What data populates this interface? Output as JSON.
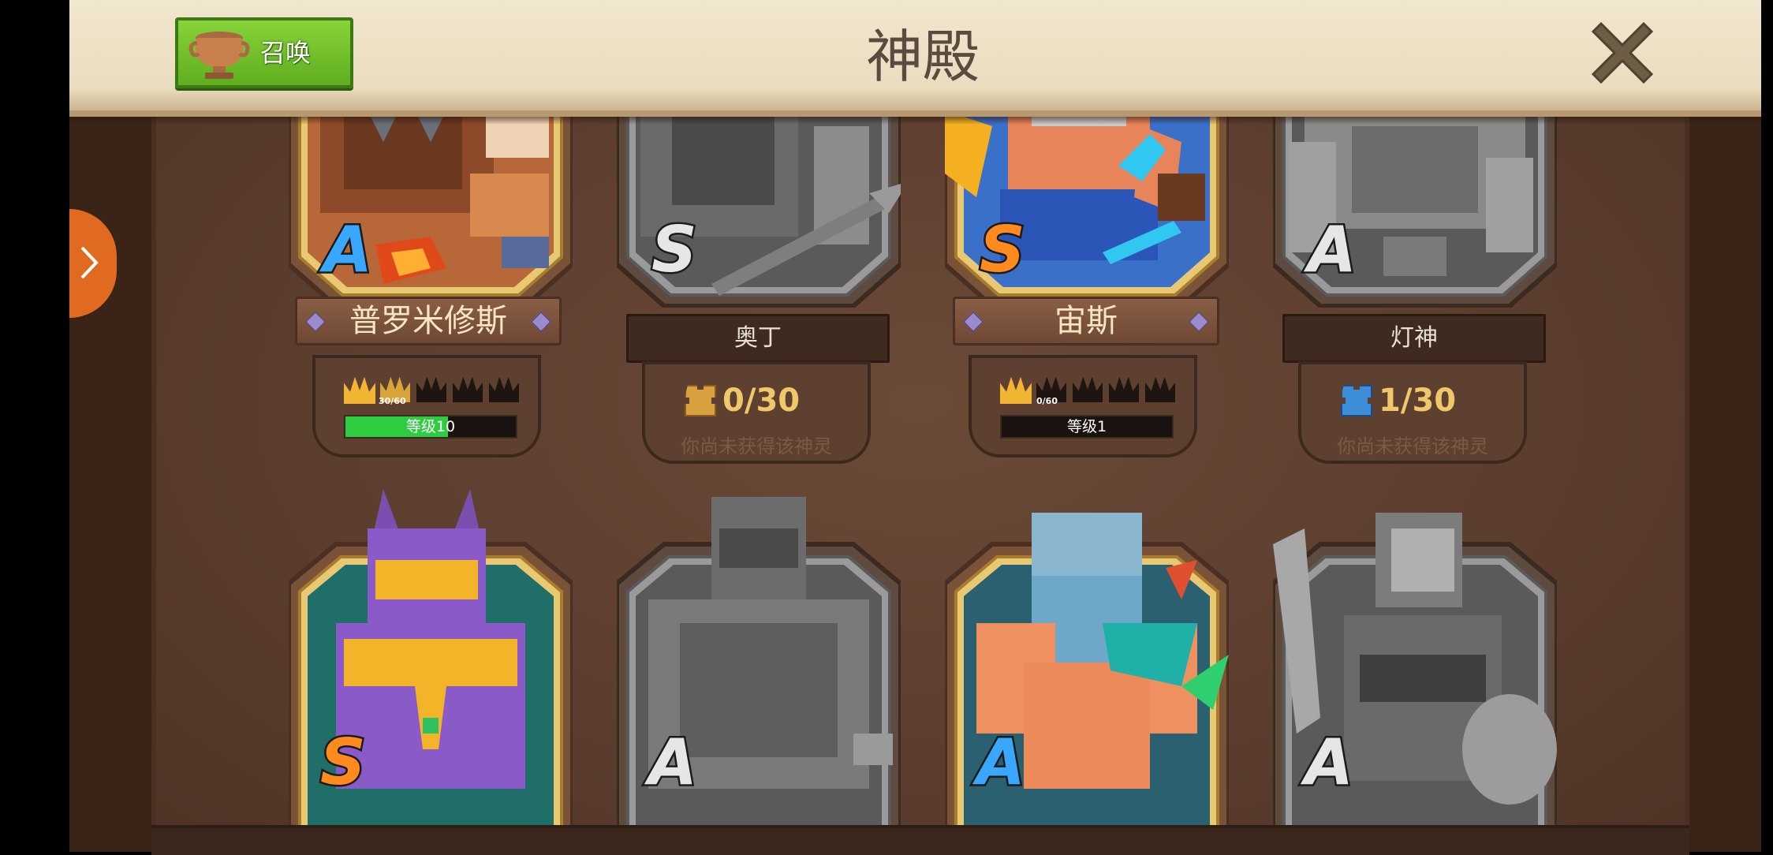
{
  "header": {
    "title": "神殿",
    "summon_label": "召唤"
  },
  "icons": {
    "summon": "trophy-urn-icon",
    "close": "close-x-icon",
    "side_tab": "chevron-right-icon"
  },
  "colors": {
    "header_bg": "#eadcbe",
    "panel_bg": "#5c3e2f",
    "summon_green": "#6cbf26",
    "grade_s": "#ff8a1e",
    "grade_a": "#3aa7ff",
    "level_green": "#2ecc40",
    "side_tab_orange": "#e06a20"
  },
  "gods_row1": [
    {
      "name": "普罗米修斯",
      "grade": "A",
      "owned": true,
      "stars": 1,
      "crown_slots": 5,
      "star_fragments": "30/60",
      "level_label": "等级10",
      "level_progress": 0.6
    },
    {
      "name": "奥丁",
      "grade": "S",
      "owned": false,
      "fragments": "0/30",
      "note": "你尚未获得该神灵"
    },
    {
      "name": "宙斯",
      "grade": "S",
      "owned": true,
      "stars": 1,
      "crown_slots": 5,
      "star_fragments": "0/60",
      "level_label": "等级1",
      "level_progress": 0.0
    },
    {
      "name": "灯神",
      "grade": "A",
      "owned": false,
      "fragments": "1/30",
      "note": "你尚未获得该神灵"
    }
  ],
  "gods_row2": [
    {
      "grade": "S",
      "owned": true
    },
    {
      "grade": "A",
      "owned": false
    },
    {
      "grade": "A",
      "owned": true
    },
    {
      "grade": "A",
      "owned": false
    }
  ]
}
